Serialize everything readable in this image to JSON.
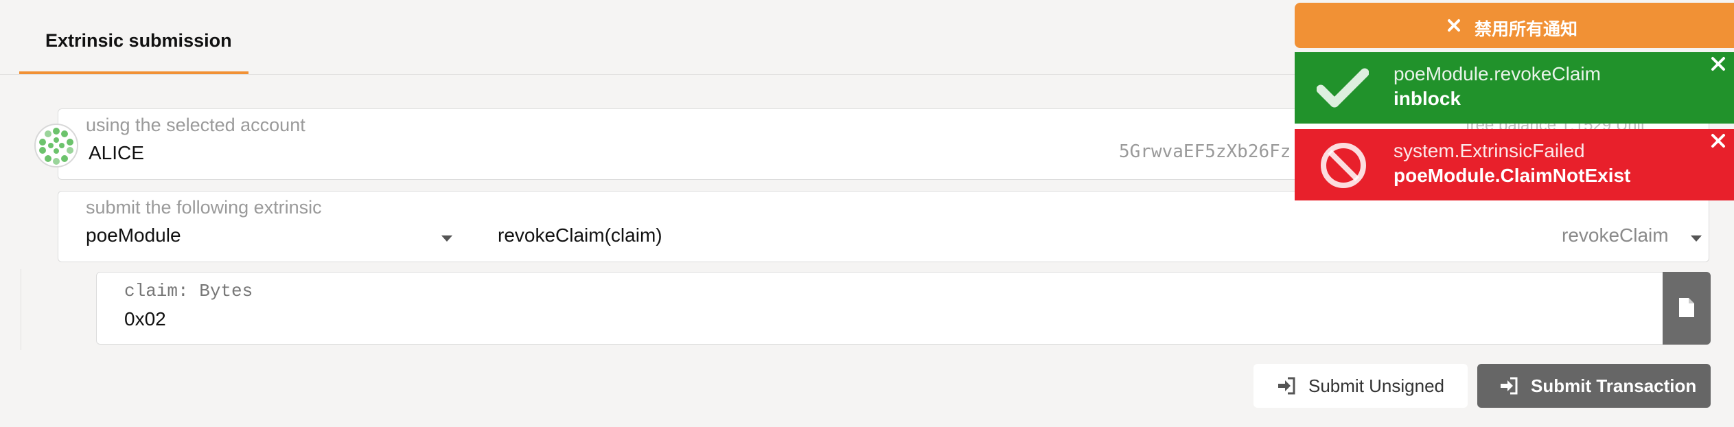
{
  "tabs": {
    "active_label": "Extrinsic submission"
  },
  "account": {
    "label": "using the selected account",
    "name": "ALICE",
    "address": "5GrwvaEF5zXb26Fz",
    "balance_label": "free balance 1.1529 Unit"
  },
  "extrinsic": {
    "label": "submit the following extrinsic",
    "module": "poeModule",
    "call": "revokeClaim(claim)",
    "method": "revokeClaim"
  },
  "param": {
    "label": "claim: Bytes",
    "value": "0x02"
  },
  "buttons": {
    "unsigned": "Submit Unsigned",
    "submit": "Submit Transaction"
  },
  "notifications": {
    "disable_all": "禁用所有通知",
    "items": [
      {
        "title": "poeModule.revokeClaim",
        "status": "inblock",
        "color": "#21922b",
        "icon": "check-icon"
      },
      {
        "title": "system.ExtrinsicFailed",
        "status": "poeModule.ClaimNotExist",
        "color": "#e8202b",
        "icon": "ban-icon"
      }
    ]
  },
  "colors": {
    "accent": "#f19135",
    "success": "#21922b",
    "error": "#e8202b"
  }
}
